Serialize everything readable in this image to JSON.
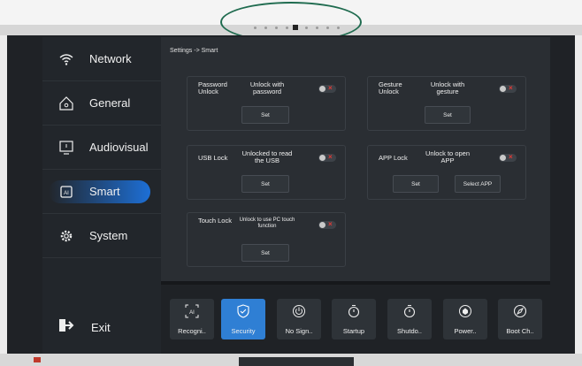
{
  "sidebar": {
    "items": [
      {
        "label": "Network",
        "icon": "wifi-icon"
      },
      {
        "label": "General",
        "icon": "home-icon"
      },
      {
        "label": "Audiovisual",
        "icon": "monitor-icon"
      },
      {
        "label": "Smart",
        "icon": "ai-chip-icon",
        "active": true
      },
      {
        "label": "System",
        "icon": "gear-icon"
      }
    ],
    "exit_label": "Exit"
  },
  "breadcrumb": "Settings -> Smart",
  "cards": {
    "password": {
      "label": "Password Unlock",
      "desc": "Unlock with password",
      "button": "Set",
      "enabled": false
    },
    "gesture": {
      "label": "Gesture Unlock",
      "desc": "Unlock with gesture",
      "button": "Set",
      "enabled": false
    },
    "usb": {
      "label": "USB Lock",
      "desc": "Unlocked to read the USB",
      "button": "Set",
      "enabled": false
    },
    "app": {
      "label": "APP Lock",
      "desc": "Unlock to open APP",
      "button": "Set",
      "button2": "Select APP",
      "enabled": false
    },
    "touch": {
      "label": "Touch Lock",
      "desc": "Unlock to use PC touch function",
      "button": "Set",
      "enabled": false
    }
  },
  "bottom_tabs": [
    {
      "label": "Recogni..",
      "icon": "ai-scan-icon"
    },
    {
      "label": "Security",
      "icon": "shield-check-icon",
      "active": true
    },
    {
      "label": "No Sign..",
      "icon": "power-icon"
    },
    {
      "label": "Startup",
      "icon": "timer-icon"
    },
    {
      "label": "Shutdo..",
      "icon": "timer-icon"
    },
    {
      "label": "Power..",
      "icon": "shield-power-icon"
    },
    {
      "label": "Boot Ch..",
      "icon": "compass-icon"
    }
  ],
  "colors": {
    "accent": "#2f7fd4",
    "toggle_off_x": "#e53935",
    "background": "#1f2226",
    "bezel_highlight": "#1f6b4f"
  }
}
